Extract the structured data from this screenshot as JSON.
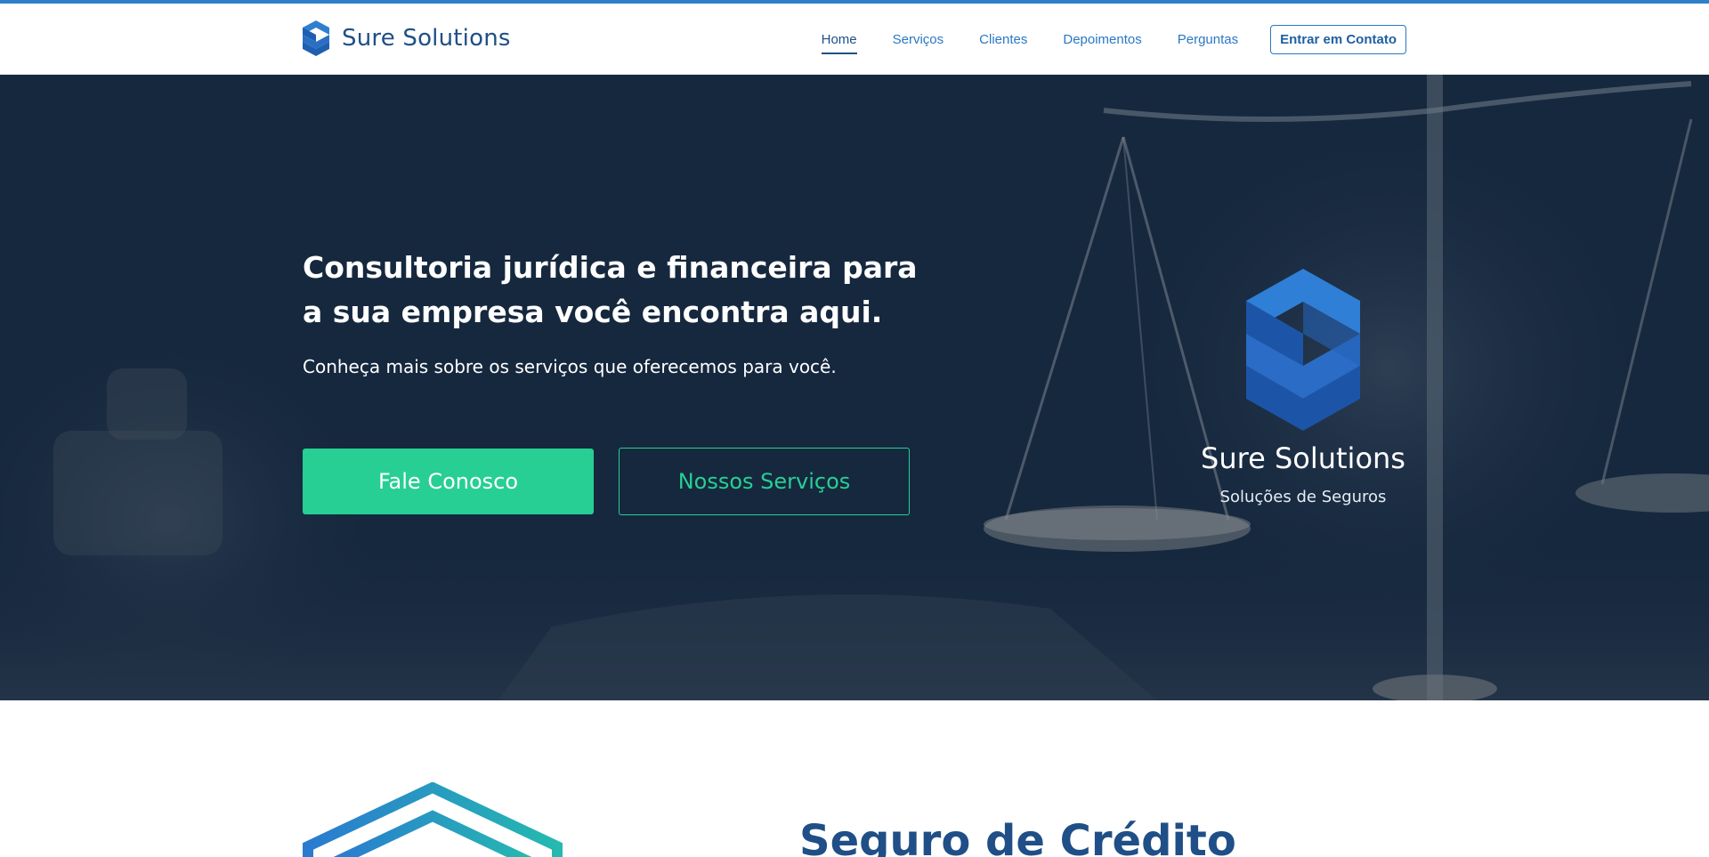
{
  "header": {
    "brand_name": "Sure Solutions",
    "logo_icon": "s-hexagon-logo-icon",
    "nav": [
      {
        "label": "Home",
        "active": true
      },
      {
        "label": "Serviços",
        "active": false
      },
      {
        "label": "Clientes",
        "active": false
      },
      {
        "label": "Depoimentos",
        "active": false
      },
      {
        "label": "Perguntas",
        "active": false
      }
    ],
    "cta_label": "Entrar em Contato"
  },
  "hero": {
    "title": "Consultoria jurídica e financeira para a sua empresa você encontra aqui.",
    "subtitle": "Conheça mais sobre os serviços que oferecemos para você.",
    "primary_button": "Fale Conosco",
    "secondary_button": "Nossos Serviços",
    "logo_name": "Sure Solutions",
    "logo_tagline": "Soluções de Seguros",
    "background_image": "scales-of-justice-and-gavel-photo"
  },
  "section": {
    "title": "Seguro de Crédito",
    "icon": "shield-outline-icon"
  },
  "colors": {
    "brand_blue": "#1f4f86",
    "link_blue": "#2a77c4",
    "accent_green": "#27cf94",
    "hero_overlay": "#15273d"
  }
}
